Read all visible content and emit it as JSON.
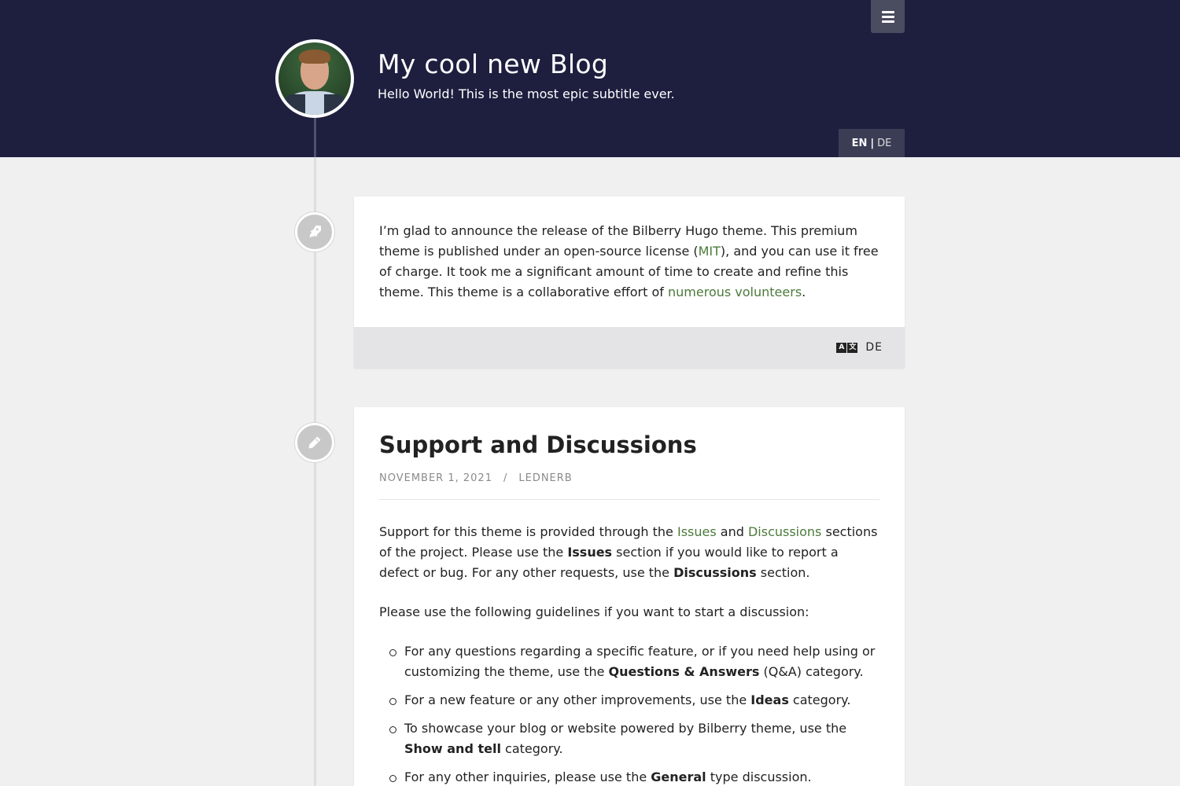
{
  "header": {
    "title": "My cool new Blog",
    "subtitle": "Hello World! This is the most epic subtitle ever.",
    "lang_active": "EN",
    "lang_sep": "|",
    "lang_other": "DE"
  },
  "post1": {
    "text_1": "I’m glad to announce the release of the Bilberry Hugo theme. This premium theme is published under an open-source license (",
    "link_mit": "MIT",
    "text_2": "), and you can use it free of charge. It took me a significant amount of time to create and refine this theme. This theme is a collaborative effort of ",
    "link_volunteers": "numerous volunteers",
    "text_3": ".",
    "footer_lang": "DE",
    "translate_glyph_a": "A",
    "translate_glyph_b": "文"
  },
  "post2": {
    "title": "Support and Discussions",
    "date": "November 1, 2021",
    "meta_sep": "/",
    "author": "lednerb",
    "p1_a": "Support for this theme is provided through the ",
    "p1_link_issues": "Issues",
    "p1_b": " and ",
    "p1_link_discussions": "Discussions",
    "p1_c": " sections of the project. Please use the ",
    "p1_bold_issues": "Issues",
    "p1_d": " section if you would like to report a defect or bug. For any other requests, use the ",
    "p1_bold_discussions": "Discussions",
    "p1_e": " section.",
    "p2": "Please use the following guidelines if you want to start a discussion:",
    "li1_a": "For any questions regarding a specific feature, or if you need help using or customizing the theme, use the ",
    "li1_b": "Questions & Answers",
    "li1_c": " (Q&A) category.",
    "li2_a": "For a new feature or any other improvements, use the ",
    "li2_b": "Ideas",
    "li2_c": " category.",
    "li3_a": "To showcase your blog or website powered by Bilberry theme, use the ",
    "li3_b": "Show and tell",
    "li3_c": " category.",
    "li4_a": "For any other inquiries, please use the ",
    "li4_b": "General",
    "li4_c": " type discussion."
  },
  "icons": {
    "menu": "hamburger-icon",
    "post1": "rocket-icon",
    "post2": "pencil-icon",
    "translate": "translate-icon"
  },
  "colors": {
    "header_bg": "#1e1f3f",
    "link": "#4b7a3a",
    "page_bg": "#f0f0f0"
  }
}
